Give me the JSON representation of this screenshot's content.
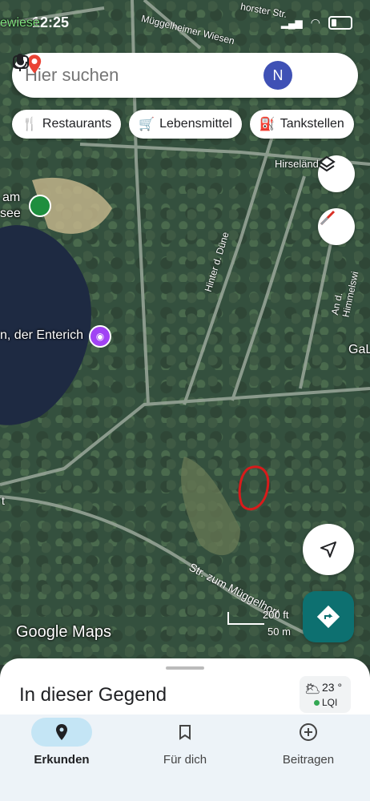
{
  "status": {
    "time": "12:25"
  },
  "search": {
    "placeholder": "Hier suchen",
    "avatar_letter": "N"
  },
  "chips": [
    {
      "label": "Restaurants"
    },
    {
      "label": "Lebensmittel"
    },
    {
      "label": "Tankstellen"
    }
  ],
  "map_labels": {
    "top_road": "Müggelheimer Wiesen",
    "top_road_right": "horster Str.",
    "top_left": "ewiese",
    "hirse": "Hirseländ",
    "hinter": "Hinter d. Düne",
    "am": "am",
    "see": "see",
    "enterich": "n, der Enterich",
    "himmel": "An d. Himmelswi",
    "gal": "GaL",
    "str_zum": "Str. zum Müggelhort",
    "str_left": "t",
    "scale_ft": "200 ft",
    "scale_m": "50 m",
    "logo": "Google Maps"
  },
  "sheet": {
    "title": "In dieser Gegend",
    "temp": "23 °",
    "lqi": "LQI"
  },
  "tabs": [
    {
      "label": "Erkunden"
    },
    {
      "label": "Für dich"
    },
    {
      "label": "Beitragen"
    }
  ]
}
